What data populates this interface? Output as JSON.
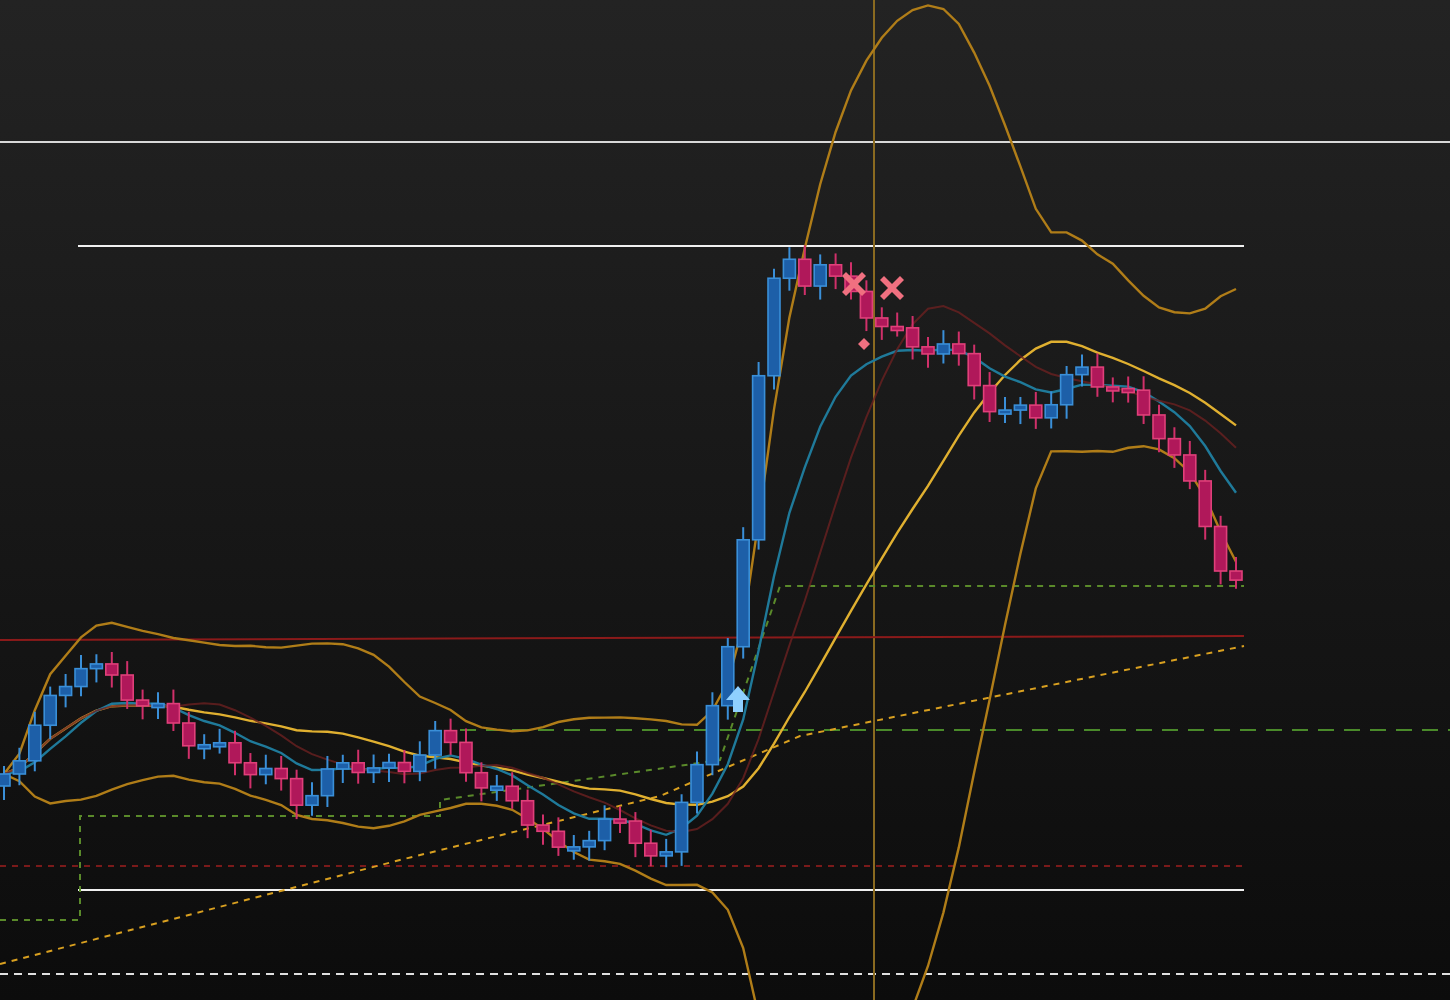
{
  "chart": {
    "signals": [
      {
        "kind": "buy"
      },
      {
        "kind": "sell"
      },
      {
        "kind": "sell"
      },
      {
        "kind": "exit"
      }
    ]
  }
}
